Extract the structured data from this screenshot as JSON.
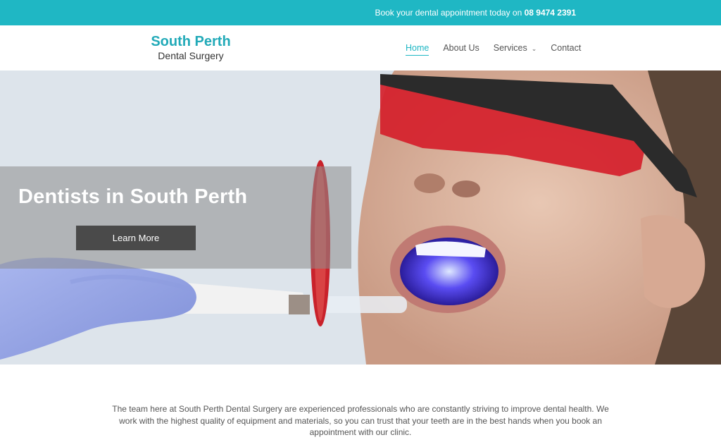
{
  "topbar": {
    "text": "Book your dental appointment today on ",
    "phone": "08 9474 2391"
  },
  "logo": {
    "main": "South Perth",
    "sub": "Dental Surgery"
  },
  "nav": {
    "items": [
      {
        "label": "Home",
        "active": true
      },
      {
        "label": "About Us"
      },
      {
        "label": "Services",
        "icon": "chevron-down-icon"
      },
      {
        "label": "Contact"
      }
    ]
  },
  "hero": {
    "title": "Dentists in South Perth",
    "button_label": "Learn More"
  },
  "intro": {
    "text": "The team here at South Perth Dental Surgery are experienced professionals who are constantly striving to improve dental health. We work with the highest quality of equipment and materials, so you can trust that your teeth are in the best hands when you book an appointment with our clinic."
  },
  "colors": {
    "accent": "#1fb7c4",
    "logo": "#22aab8",
    "button": "#4a4a4a"
  }
}
